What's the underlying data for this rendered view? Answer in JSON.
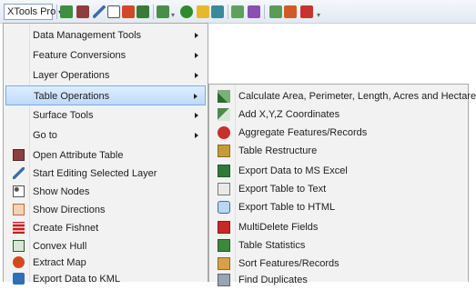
{
  "toolbar": {
    "menu_button_label": "XTools Pro",
    "icons": [
      "layer-add-icon",
      "table-icon",
      "pencil-icon",
      "nodes-icon",
      "grid-icon",
      "table-options-icon",
      "dropdown-icon",
      "globe-icon",
      "info-icon",
      "zoom-icon",
      "map-icon",
      "window-icon",
      "chart-icon",
      "measure-icon",
      "more-icon"
    ]
  },
  "menu": {
    "items": [
      {
        "label": "Data Management Tools",
        "submenu": true
      },
      {
        "label": "Feature Conversions",
        "submenu": true
      },
      {
        "label": "Layer Operations",
        "submenu": true
      },
      {
        "label": "Table Operations",
        "submenu": true,
        "highlighted": true
      },
      {
        "label": "Surface Tools",
        "submenu": true
      },
      {
        "label": "Go to",
        "submenu": true
      },
      {
        "label": "Open Attribute Table",
        "icon": "table-icon"
      },
      {
        "label": "Start Editing Selected Layer",
        "icon": "pencil-icon"
      },
      {
        "label": "Show Nodes",
        "icon": "nodes-icon"
      },
      {
        "label": "Show Directions",
        "icon": "directions-icon"
      },
      {
        "label": "Create Fishnet",
        "icon": "fishnet-icon"
      },
      {
        "label": "Convex Hull",
        "icon": "convex-hull-icon"
      },
      {
        "label": "Extract Map",
        "icon": "extract-map-icon"
      },
      {
        "label": "Export Data to KML",
        "icon": "kml-icon"
      }
    ]
  },
  "submenu": {
    "items": [
      {
        "label": "Calculate Area, Perimeter, Length, Acres and Hectares",
        "icon": "calculate-icon"
      },
      {
        "label": "Add X,Y,Z Coordinates",
        "icon": "xyz-icon"
      },
      {
        "label": "Aggregate Features/Records",
        "icon": "aggregate-icon"
      },
      {
        "label": "Table Restructure",
        "icon": "restructure-icon"
      },
      {
        "label": "Export Data to MS Excel",
        "icon": "excel-icon"
      },
      {
        "label": "Export Table to Text",
        "icon": "text-export-icon"
      },
      {
        "label": "Export Table to HTML",
        "icon": "html-icon"
      },
      {
        "label": "MultiDelete Fields",
        "icon": "multidelete-icon"
      },
      {
        "label": "Table Statistics",
        "icon": "statistics-icon"
      },
      {
        "label": "Sort Features/Records",
        "icon": "sort-icon"
      },
      {
        "label": "Find Duplicates",
        "icon": "duplicates-icon"
      }
    ]
  }
}
